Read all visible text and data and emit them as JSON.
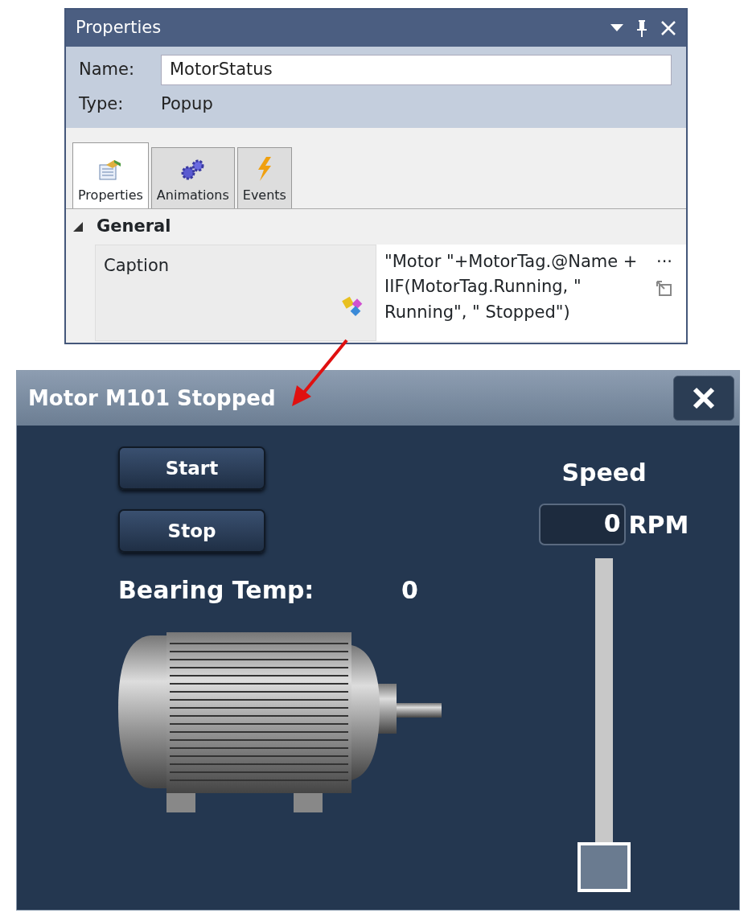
{
  "properties_panel": {
    "title": "Properties",
    "name_label": "Name:",
    "name_value": "MotorStatus",
    "type_label": "Type:",
    "type_value": "Popup",
    "tabs": [
      {
        "label": "Properties",
        "kind": "properties",
        "selected": true
      },
      {
        "label": "Animations",
        "kind": "animations",
        "selected": false
      },
      {
        "label": "Events",
        "kind": "events",
        "selected": false
      }
    ],
    "section": {
      "title": "General",
      "expanded": true
    },
    "property": {
      "name": "Caption",
      "value": "\"Motor \"+MotorTag.@Name + IIF(MotorTag.Running, \" Running\", \" Stopped\")",
      "more": "···"
    }
  },
  "popup": {
    "title": "Motor M101 Stopped",
    "buttons": [
      {
        "label": "Start"
      },
      {
        "label": "Stop"
      }
    ],
    "bearing_label": "Bearing Temp:",
    "bearing_value": "0",
    "speed_label": "Speed",
    "speed_value": "0",
    "speed_unit": "RPM",
    "slider": {
      "level": 0
    }
  }
}
